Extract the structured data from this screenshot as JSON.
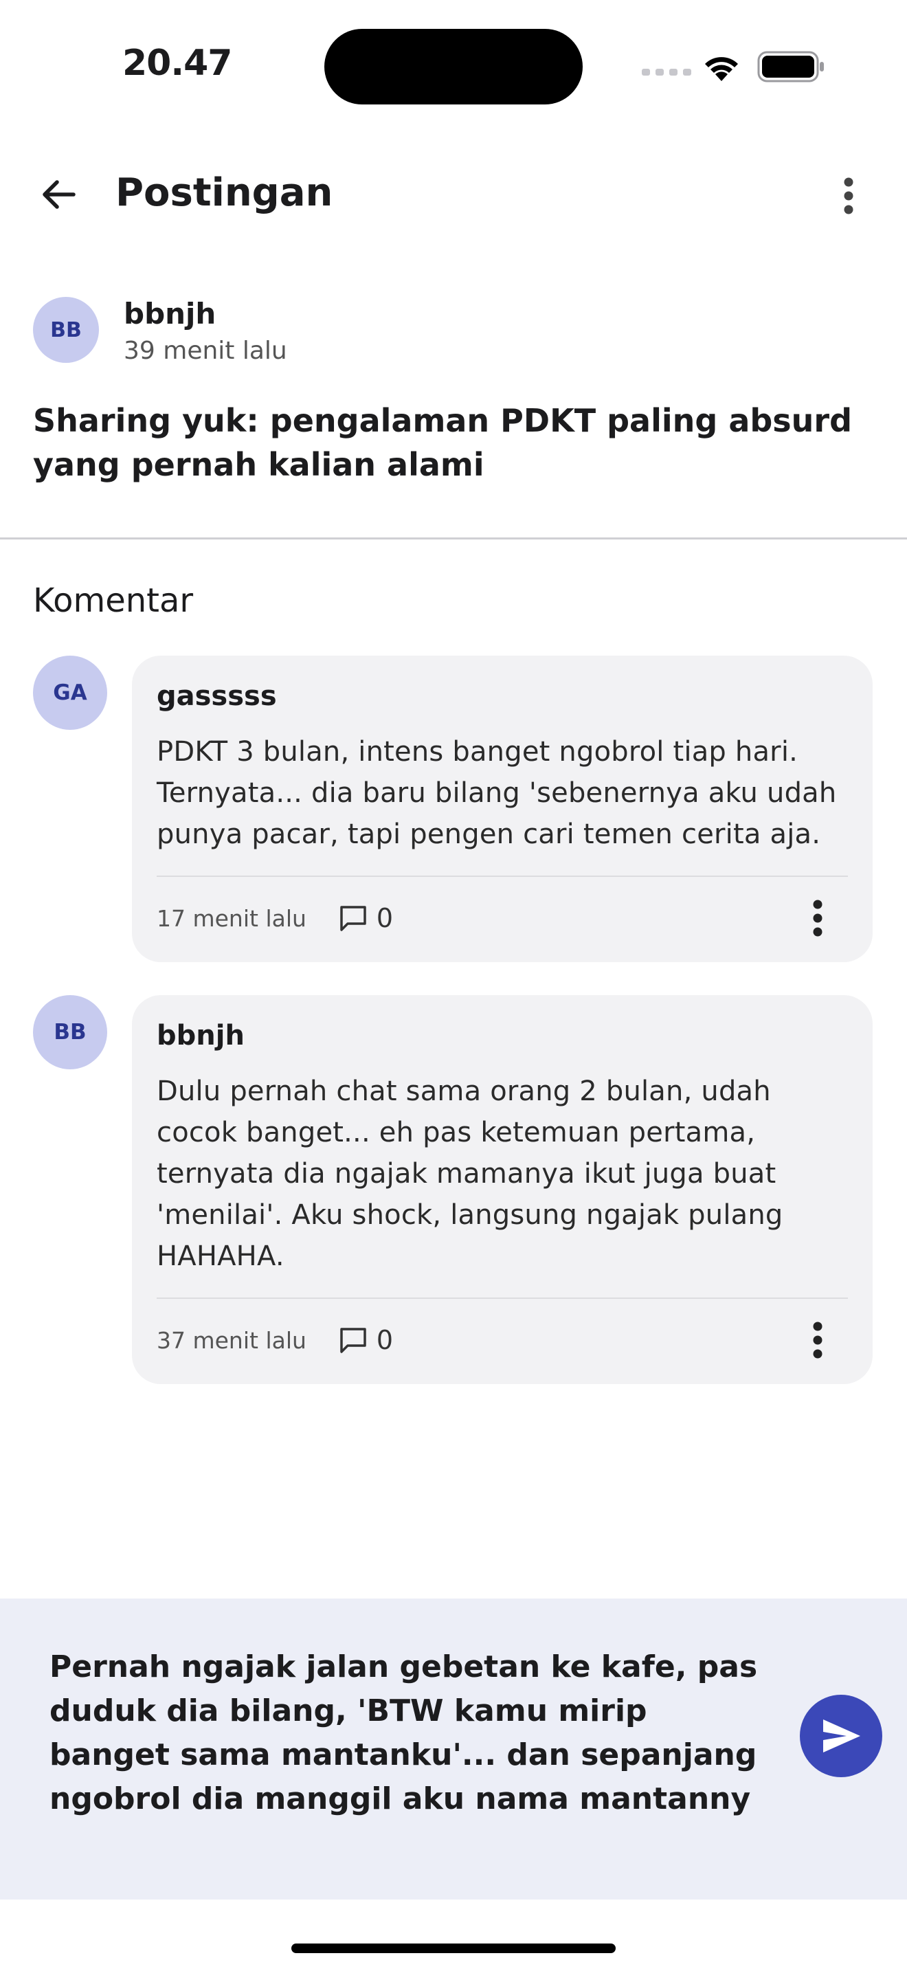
{
  "status_bar": {
    "time": "20.47"
  },
  "app_bar": {
    "title": "Postingan"
  },
  "post": {
    "avatar_initials": "BB",
    "author": "bbnjh",
    "time": "39 menit lalu",
    "content": "Sharing yuk: pengalaman PDKT paling absurd yang pernah kalian alami"
  },
  "comments_heading": "Komentar",
  "comments": [
    {
      "avatar_initials": "GA",
      "author": "gasssss",
      "text": "PDKT 3 bulan, intens banget ngobrol tiap hari. Ternyata... dia baru bilang 'sebenernya aku udah punya pacar, tapi pengen cari temen cerita aja.",
      "time": "17 menit lalu",
      "reply_count": "0"
    },
    {
      "avatar_initials": "BB",
      "author": "bbnjh",
      "text": "Dulu pernah chat sama orang 2 bulan, udah cocok banget... eh pas ketemuan pertama, ternyata dia ngajak mamanya ikut juga buat 'menilai'. Aku shock, langsung ngajak pulang HAHAHA.",
      "time": "37 menit lalu",
      "reply_count": "0"
    }
  ],
  "composer": {
    "value": "Pernah ngajak jalan gebetan ke kafe, pas duduk dia bilang, 'BTW kamu mirip banget sama mantanku'... dan sepanjang ngobrol dia manggil aku nama mantanny"
  },
  "icons": {
    "back": "arrow-left-icon",
    "overflow": "more-vertical-icon",
    "reply": "comment-icon",
    "send": "send-icon",
    "wifi": "wifi-icon",
    "battery": "battery-icon"
  },
  "colors": {
    "accent": "#3b48b8",
    "avatar_bg": "#c7cbef",
    "avatar_text": "#2a3690",
    "card_bg": "#f2f2f4",
    "composer_bg": "#eceef7"
  }
}
